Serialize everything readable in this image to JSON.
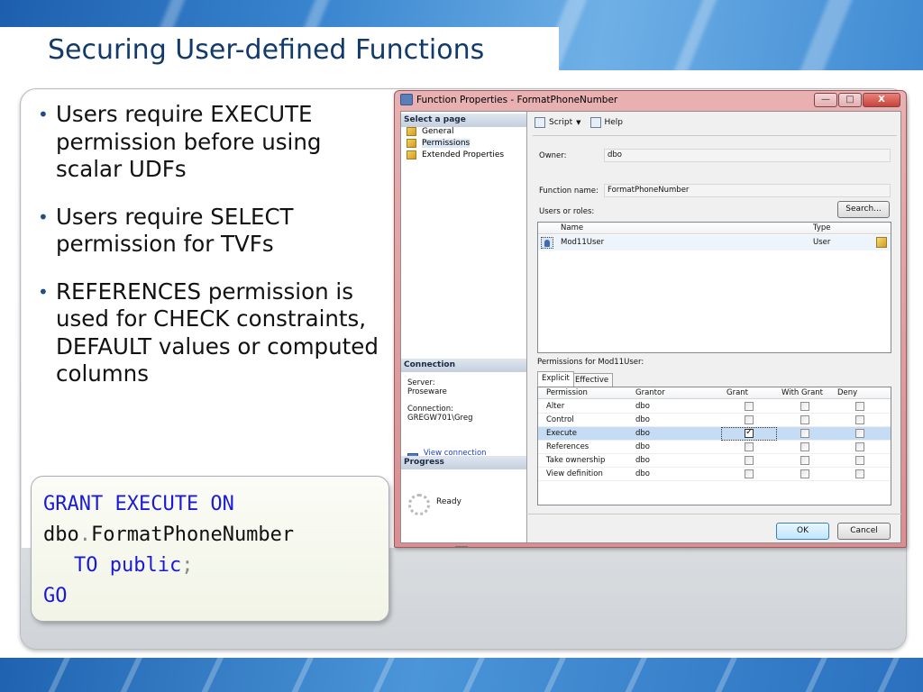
{
  "slide": {
    "title": "Securing User-defined Functions",
    "bullets": [
      "Users require EXECUTE permission before using scalar UDFs",
      "Users require SELECT permission for TVFs",
      "REFERENCES permission is used for CHECK constraints, DEFAULT values or computed columns"
    ],
    "code": {
      "line1_kw": "GRANT EXECUTE ON",
      "line2_schema": "dbo",
      "line2_dot": ".",
      "line2_name": "FormatPhoneNumber",
      "line3_kw": "TO public",
      "line3_semi": ";",
      "line4_kw": "GO"
    }
  },
  "dialog": {
    "title": "Function Properties - FormatPhoneNumber",
    "window_buttons": {
      "minimize": "—",
      "maximize": "□",
      "close": "X"
    },
    "left_pane": {
      "select_page_header": "Select a page",
      "pages": [
        {
          "label": "General",
          "icon": "page-icon"
        },
        {
          "label": "Permissions",
          "icon": "page-icon",
          "selected": true
        },
        {
          "label": "Extended Properties",
          "icon": "page-icon"
        }
      ],
      "connection_header": "Connection",
      "server_label": "Server:",
      "server_value": "Proseware",
      "connection_label": "Connection:",
      "connection_value": "GREGW701\\Greg",
      "view_connection_link": "View connection properties",
      "progress_header": "Progress",
      "progress_status": "Ready"
    },
    "toolbar": {
      "script": "Script",
      "help": "Help"
    },
    "owner_label": "Owner:",
    "owner_value": "dbo",
    "function_name_label": "Function name:",
    "function_name_value": "FormatPhoneNumber",
    "users_or_roles_label": "Users or roles:",
    "search_button": "Search...",
    "users_grid": {
      "columns": [
        "Name",
        "Type"
      ],
      "rows": [
        {
          "name": "Mod11User",
          "type": "User"
        }
      ]
    },
    "permissions_for_label": "Permissions for Mod11User:",
    "tabs": [
      "Explicit",
      "Effective"
    ],
    "active_tab": "Explicit",
    "permissions_grid": {
      "columns": [
        "Permission",
        "Grantor",
        "Grant",
        "With Grant",
        "Deny"
      ],
      "rows": [
        {
          "permission": "Alter",
          "grantor": "dbo",
          "grant": false,
          "with_grant": false,
          "deny": false
        },
        {
          "permission": "Control",
          "grantor": "dbo",
          "grant": false,
          "with_grant": false,
          "deny": false
        },
        {
          "permission": "Execute",
          "grantor": "dbo",
          "grant": true,
          "with_grant": false,
          "deny": false,
          "selected": true
        },
        {
          "permission": "References",
          "grantor": "dbo",
          "grant": false,
          "with_grant": false,
          "deny": false
        },
        {
          "permission": "Take ownership",
          "grantor": "dbo",
          "grant": false,
          "with_grant": false,
          "deny": false
        },
        {
          "permission": "View definition",
          "grantor": "dbo",
          "grant": false,
          "with_grant": false,
          "deny": false
        }
      ]
    },
    "ok_button": "OK",
    "cancel_button": "Cancel"
  }
}
